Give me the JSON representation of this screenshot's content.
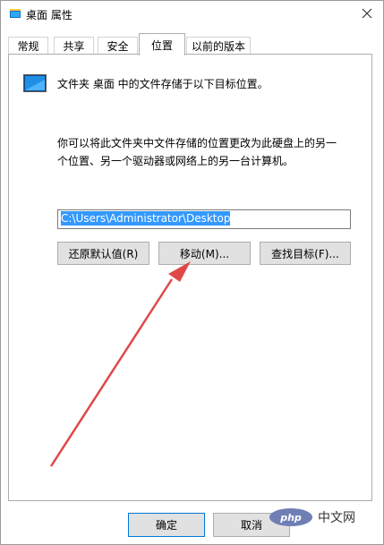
{
  "window": {
    "title": "桌面 属性"
  },
  "tabs": [
    {
      "label": "常规"
    },
    {
      "label": "共享"
    },
    {
      "label": "安全"
    },
    {
      "label": "位置",
      "active": true
    },
    {
      "label": "以前的版本"
    }
  ],
  "location": {
    "info_text": "文件夹 桌面 中的文件存储于以下目标位置。",
    "description": "你可以将此文件夹中文件存储的位置更改为此硬盘上的另一个位置、另一个驱动器或网络上的另一台计算机。",
    "path_value": "C:\\Users\\Administrator\\Desktop",
    "restore_default_label": "还原默认值(R)",
    "move_label": "移动(M)...",
    "find_target_label": "查找目标(F)..."
  },
  "footer": {
    "ok_label": "确定",
    "cancel_label": "取消"
  },
  "watermark": {
    "logo_text": "php",
    "text": "中文网"
  },
  "colors": {
    "selection": "#3399ff",
    "arrow": "#e04848",
    "accent": "#0078d7"
  }
}
